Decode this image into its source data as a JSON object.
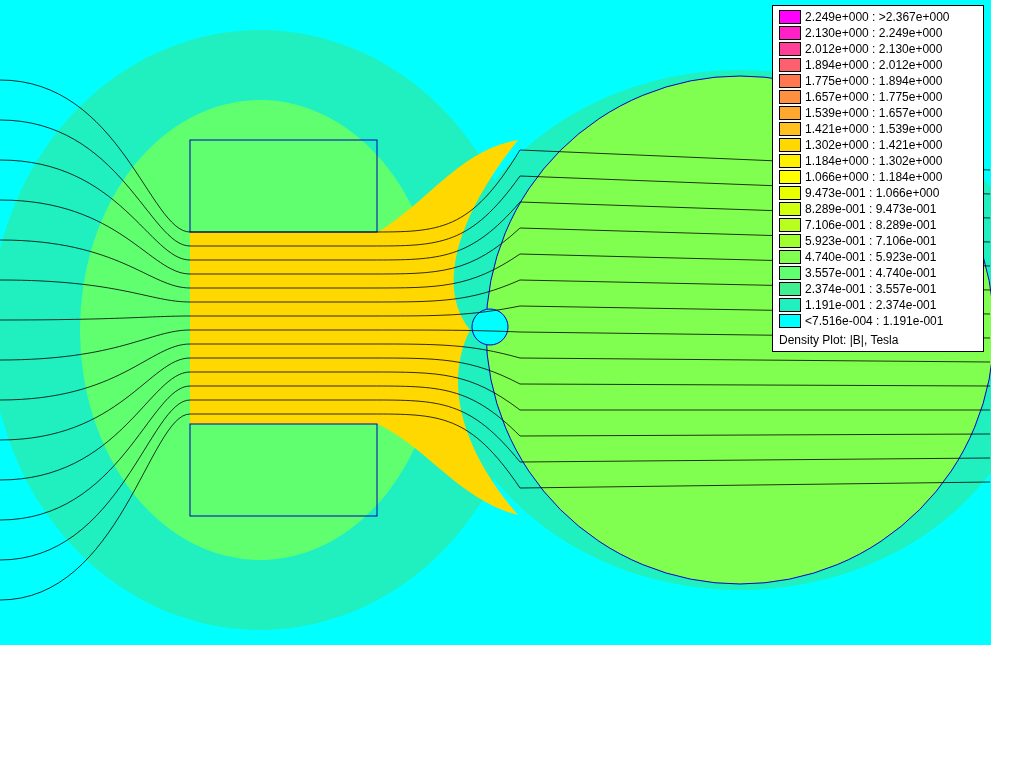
{
  "legend": {
    "items": [
      {
        "label": "2.249e+000 : >2.367e+000",
        "color": "#ff00ff"
      },
      {
        "label": "2.130e+000 : 2.249e+000",
        "color": "#ff20c8"
      },
      {
        "label": "2.012e+000 : 2.130e+000",
        "color": "#ff4098"
      },
      {
        "label": "1.894e+000 : 2.012e+000",
        "color": "#ff6070"
      },
      {
        "label": "1.775e+000 : 1.894e+000",
        "color": "#ff7850"
      },
      {
        "label": "1.657e+000 : 1.775e+000",
        "color": "#ff9040"
      },
      {
        "label": "1.539e+000 : 1.657e+000",
        "color": "#ffa830"
      },
      {
        "label": "1.421e+000 : 1.539e+000",
        "color": "#ffc020"
      },
      {
        "label": "1.302e+000 : 1.421e+000",
        "color": "#ffd800"
      },
      {
        "label": "1.184e+000 : 1.302e+000",
        "color": "#fff000"
      },
      {
        "label": "1.066e+000 : 1.184e+000",
        "color": "#ffff00"
      },
      {
        "label": "9.473e-001 : 1.066e+000",
        "color": "#e8ff00"
      },
      {
        "label": "8.289e-001 : 9.473e-001",
        "color": "#d0ff10"
      },
      {
        "label": "7.106e-001 : 8.289e-001",
        "color": "#b8ff20"
      },
      {
        "label": "5.923e-001 : 7.106e-001",
        "color": "#a0ff30"
      },
      {
        "label": "4.740e-001 : 5.923e-001",
        "color": "#80ff50"
      },
      {
        "label": "3.557e-001 : 4.740e-001",
        "color": "#60ff70"
      },
      {
        "label": "2.374e-001 : 3.557e-001",
        "color": "#40f090"
      },
      {
        "label": "1.191e-001 : 2.374e-001",
        "color": "#20f0c0"
      },
      {
        "label": "<7.516e-004 : 1.191e-001",
        "color": "#00ffff"
      }
    ],
    "caption": "Density Plot: |B|, Tesla"
  }
}
